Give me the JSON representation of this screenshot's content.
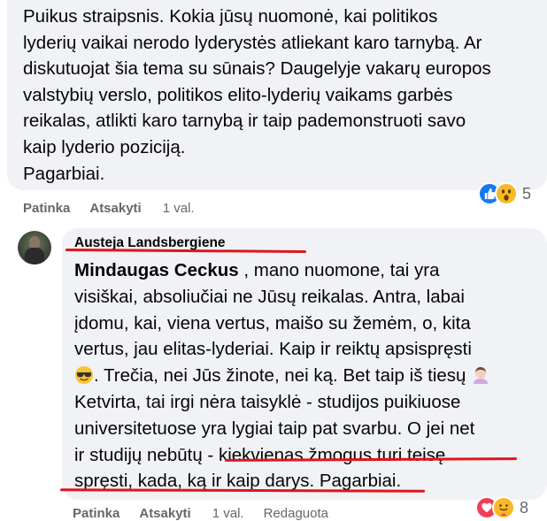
{
  "comment1": {
    "lines": [
      "Puikus straipsnis. Kokia jūsų nuomonė, kai politikos",
      "lyderių vaikai nerodo lyderystės atliekant karo tarnybą. Ar",
      "diskutuojat šia tema su sūnais? Daugelyje vakarų europos",
      "valstybių verslo, politikos elito-lyderių vaikams garbės",
      "reikalas, atlikti karo tarnybą ir taip pademonstruoti savo",
      "kaip lyderio poziciją."
    ],
    "sign_off": "Pagarbiai.",
    "reactions": {
      "icons": [
        "like-icon",
        "wow-icon"
      ],
      "count": "5"
    },
    "actions": {
      "like": "Patinka",
      "reply": "Atsakyti",
      "time": "1 val."
    }
  },
  "comment2": {
    "author": "Austeja Landsbergiene",
    "mention": "Mindaugas Ceckus",
    "lines": [
      " , mano nuomone, tai yra",
      "visiškai, absoliučiai ne Jūsų reikalas. Antra, labai",
      "įdomu, kai, viena vertus, maišo su žemėm, o, kita",
      "vertus, jau elitas-lyderiai. Kaip ir reiktų apsispręsti",
      ". Trečia, nei Jūs žinote, nei ką. Bet taip iš tiesų",
      "Ketvirta, tai irgi nėra taisyklė - studijos puikiuose",
      "universitetuose yra lygiai taip pat svarbu. O jei net",
      "ir studijų nebūtų - kiekvienas žmogus turi teisę",
      "spręsti, kada, ką ir kaip darys. Pagarbiai."
    ],
    "reactions": {
      "icons": [
        "love-icon",
        "care-icon"
      ],
      "count": "8"
    },
    "actions": {
      "like": "Patinka",
      "reply": "Atsakyti",
      "time": "1 val.",
      "edited": "Redaguota"
    }
  },
  "colors": {
    "bubble": "#f0f2f5",
    "underline": "#e0141b",
    "secondary_text": "#65676b"
  }
}
